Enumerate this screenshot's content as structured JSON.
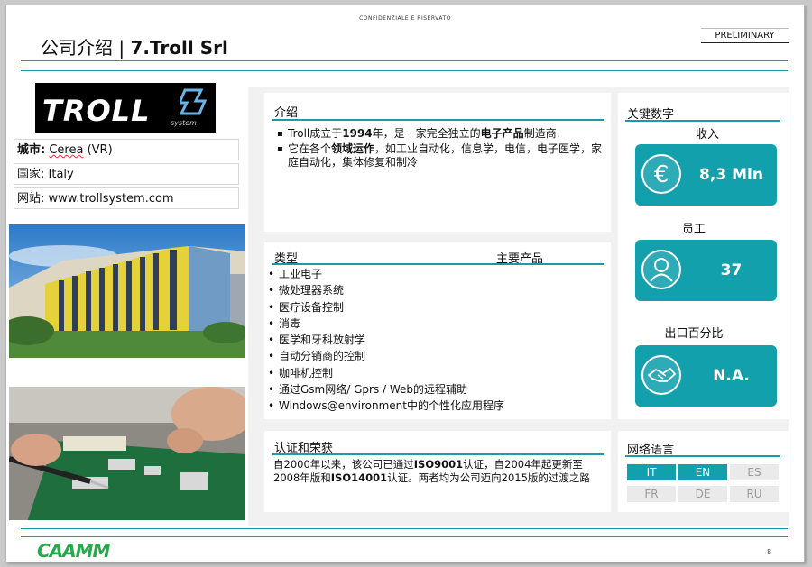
{
  "header": {
    "confidential": "CONFIDENZIALE E RISERVATO",
    "title_prefix": "公司介绍 | ",
    "title_company": "7.Troll Srl",
    "preliminary": "PRELIMINARY"
  },
  "logo": {
    "text": "TROLL",
    "sub": "system"
  },
  "company": {
    "city_label": "城市:",
    "city_value": "Cerea",
    "city_suffix": " (VR)",
    "country_label": "国家:",
    "country_value": "Italy",
    "website_label": "网站:",
    "website_value": "www.trollsystem.com"
  },
  "intro": {
    "title": "介绍",
    "b1_pre": "Troll成立于",
    "b1_year": "1994",
    "b1_mid": "年，是一家完全独立的",
    "b1_bold": "电子产品",
    "b1_post": "制造商.",
    "b2_pre": "它在各个",
    "b2_bold": "领域运作",
    "b2_post": "，如工业自动化，信息学，电信，电子医学，家庭自动化，集体修复和制冷"
  },
  "products": {
    "col1": "类型",
    "col2": "主要产品",
    "items": [
      "工业电子",
      "微处理器系统",
      "医疗设备控制",
      "消毒",
      "医学和牙科放射学",
      "自动分销商的控制",
      "咖啡机控制",
      "通过Gsm网络/ Gprs / Web的远程辅助",
      "Windows@environment中的个性化应用程序"
    ]
  },
  "cert": {
    "title": "认证和荣获",
    "p1": "自2000年以来，该公司已通过",
    "iso9001": "ISO9001",
    "p2": "认证，自2004年起更新至2008年版和",
    "iso14001": "ISO14001",
    "p3": "认证。两者均为公司迈向2015版的过渡之路"
  },
  "kpis": {
    "title": "关键数字",
    "items": [
      {
        "label": "收入",
        "value": "8,3 Mln",
        "icon": "euro-icon"
      },
      {
        "label": "员工",
        "value": "37",
        "icon": "person-icon"
      },
      {
        "label": "出口百分比",
        "value": "N.A.",
        "icon": "handshake-icon"
      }
    ]
  },
  "languages": {
    "title": "网络语言",
    "items": [
      {
        "code": "IT",
        "active": true
      },
      {
        "code": "EN",
        "active": true
      },
      {
        "code": "ES",
        "active": false
      },
      {
        "code": "FR",
        "active": false
      },
      {
        "code": "DE",
        "active": false
      },
      {
        "code": "RU",
        "active": false
      }
    ]
  },
  "footer": {
    "logo": "CAAMM",
    "page": "8"
  },
  "colors": {
    "accent": "#12a0ac",
    "line": "#1b9ba8"
  }
}
